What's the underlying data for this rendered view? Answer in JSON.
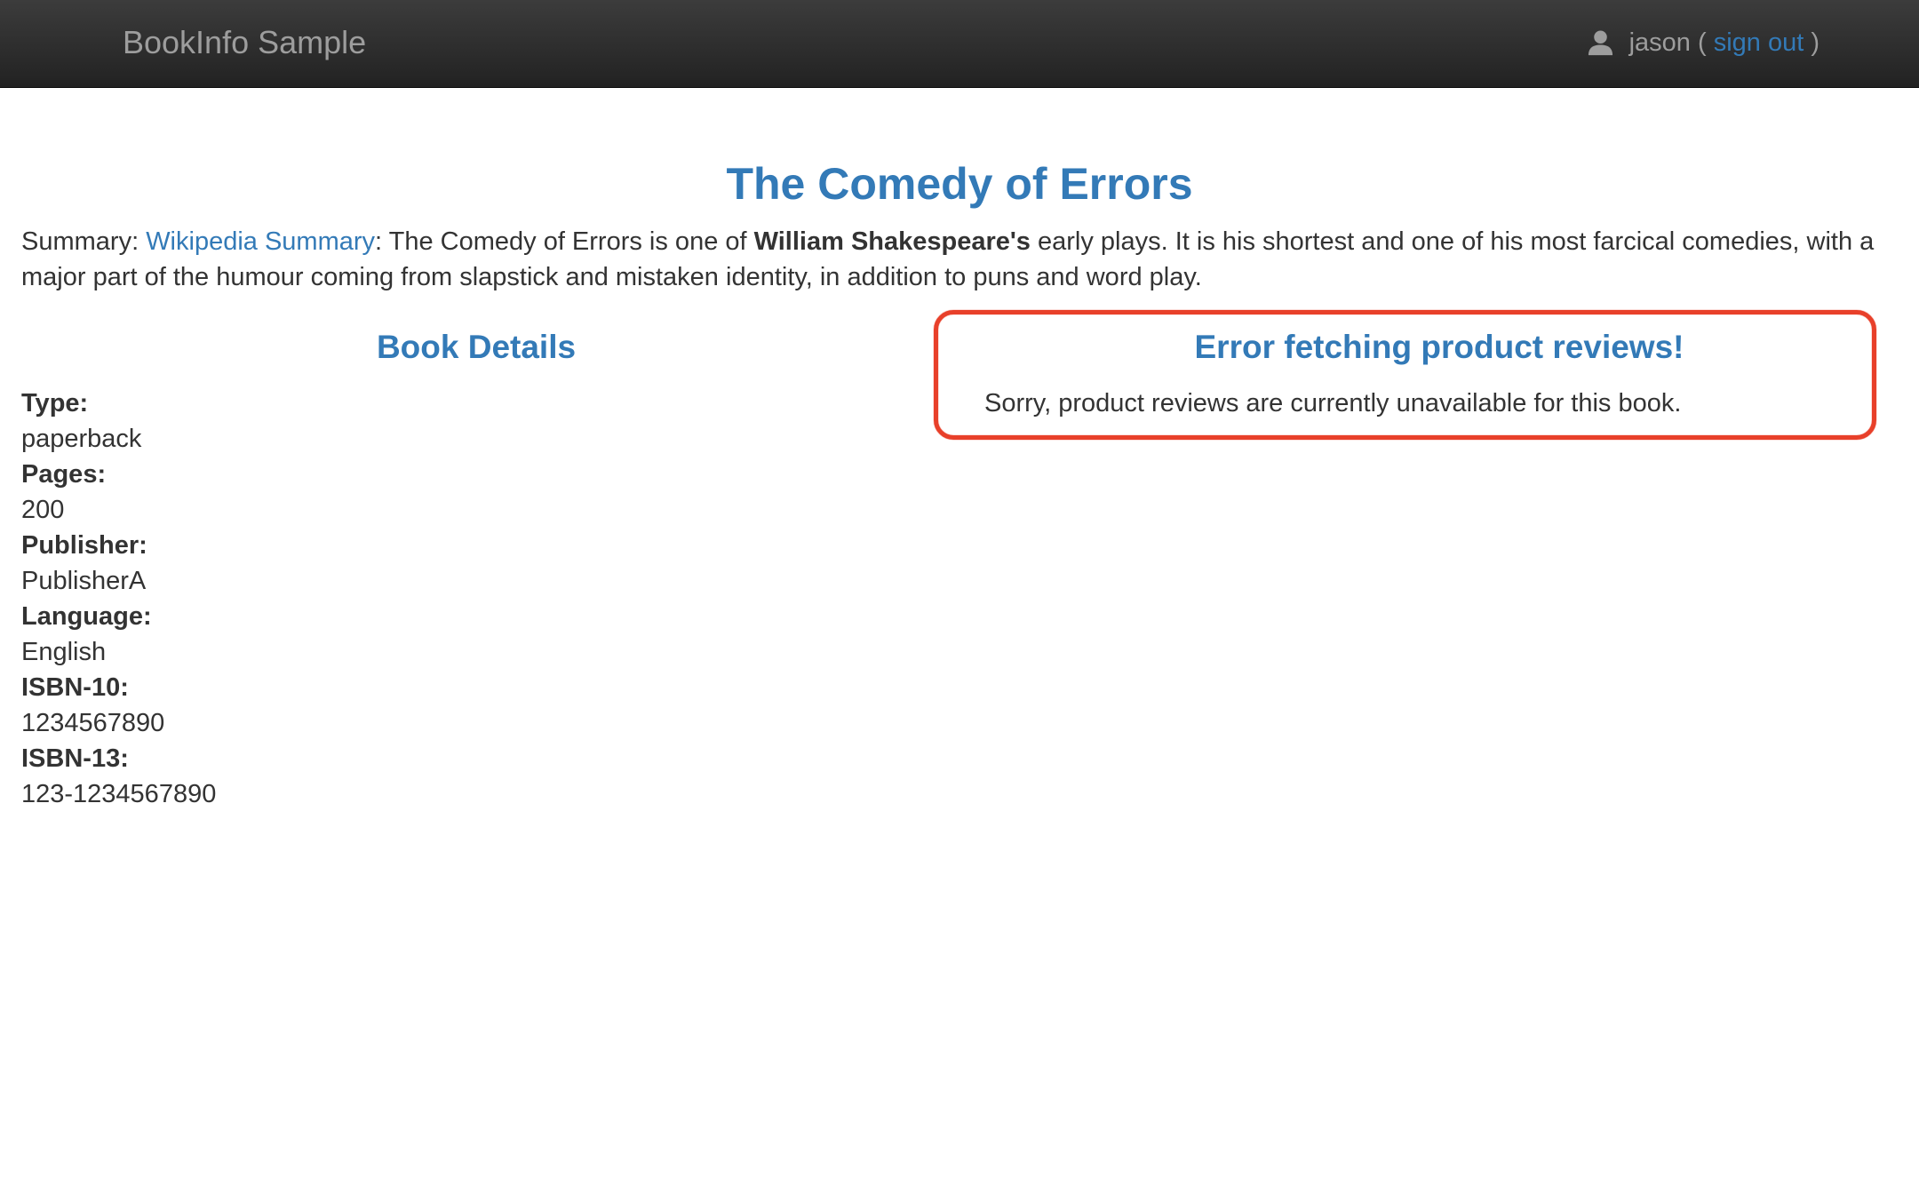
{
  "navbar": {
    "brand": "BookInfo Sample",
    "user": {
      "icon": "user-icon",
      "username": "jason",
      "open_paren": " ( ",
      "signout_label": "sign out",
      "close_paren": " )"
    }
  },
  "product": {
    "title": "The Comedy of Errors",
    "summary": {
      "prefix": "Summary: ",
      "link_text": "Wikipedia Summary",
      "text_before_bold": ": The Comedy of Errors is one of ",
      "bold_text": "William Shakespeare's",
      "text_after_bold": " early plays. It is his shortest and one of his most farcical comedies, with a major part of the humour coming from slapstick and mistaken identity, in addition to puns and word play."
    }
  },
  "details": {
    "heading": "Book Details",
    "fields": [
      {
        "label": "Type:",
        "value": "paperback"
      },
      {
        "label": "Pages:",
        "value": "200"
      },
      {
        "label": "Publisher:",
        "value": "PublisherA"
      },
      {
        "label": "Language:",
        "value": "English"
      },
      {
        "label": "ISBN-10:",
        "value": "1234567890"
      },
      {
        "label": "ISBN-13:",
        "value": "123-1234567890"
      }
    ]
  },
  "reviews": {
    "heading": "Error fetching product reviews!",
    "message": "Sorry, product reviews are currently unavailable for this book."
  },
  "colors": {
    "navbar_bg": "#222222",
    "link": "#337ab7",
    "annotation": "#e8402a",
    "muted": "#9d9d9d"
  }
}
